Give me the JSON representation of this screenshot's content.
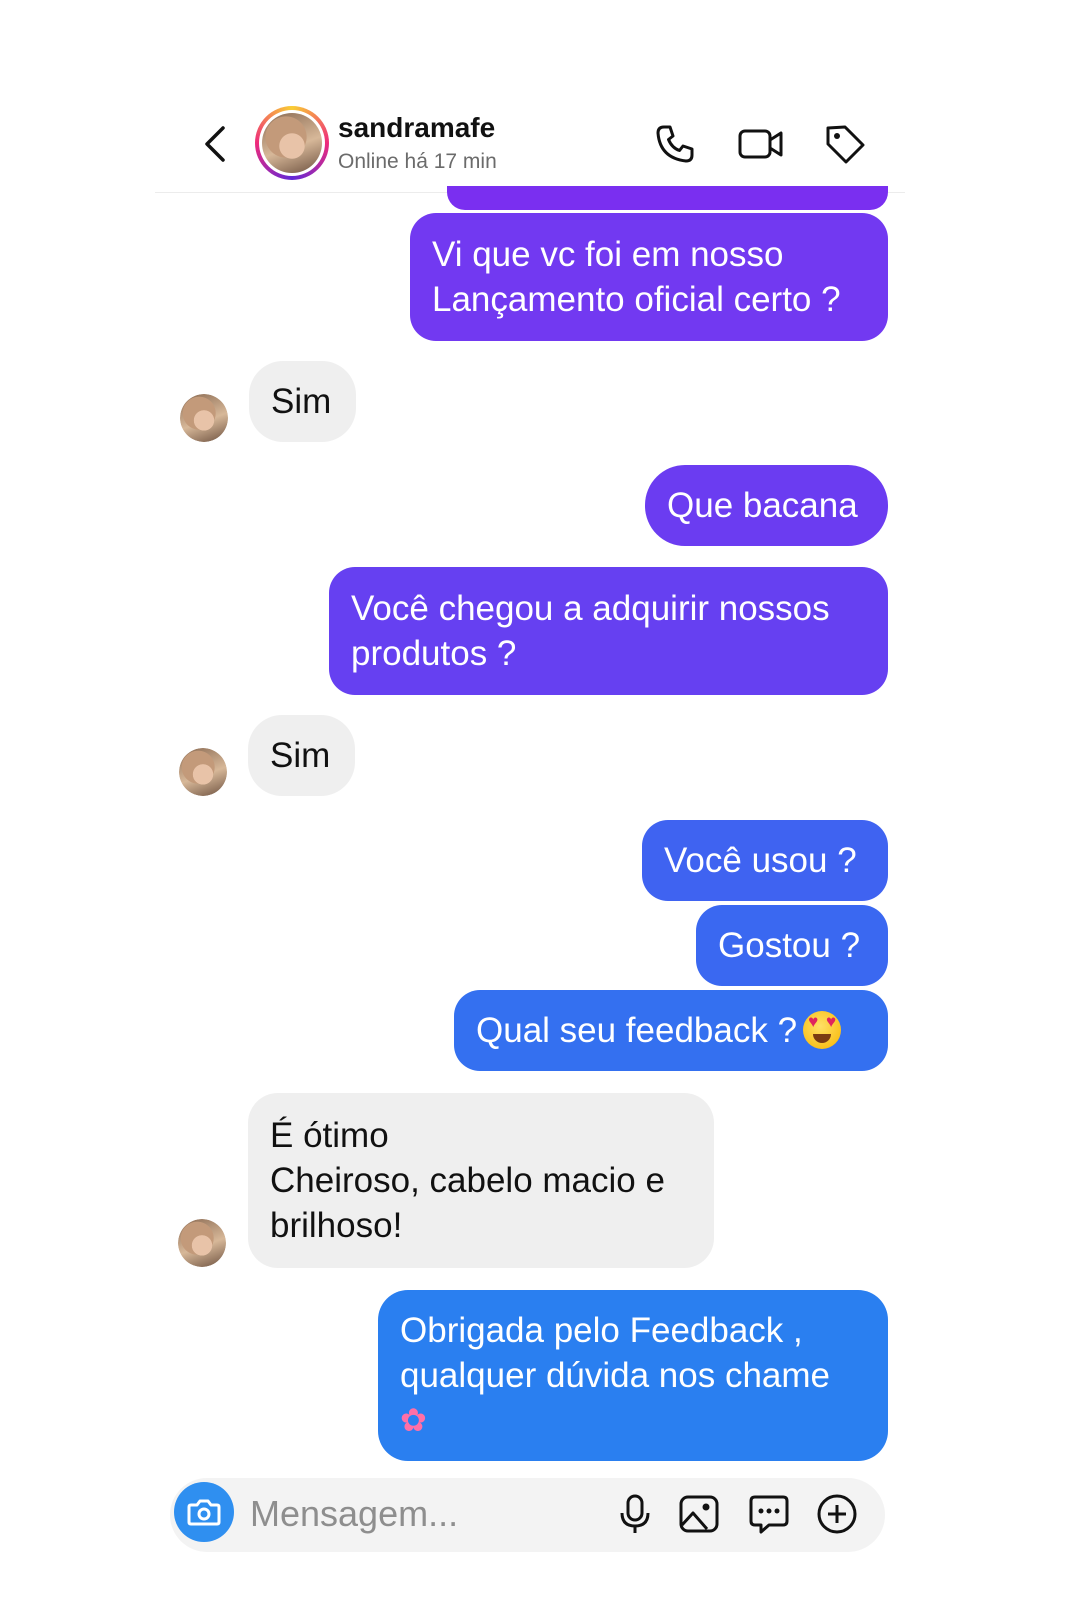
{
  "header": {
    "username": "sandramafe",
    "status": "Online há 17 min"
  },
  "messages": [
    {
      "side": "out",
      "text": "Vi que vc foi em nosso Lançamento oficial certo ?"
    },
    {
      "side": "in",
      "text": "Sim"
    },
    {
      "side": "out",
      "text": "Que bacana"
    },
    {
      "side": "out",
      "text": "Você chegou a adquirir nossos produtos ?"
    },
    {
      "side": "in",
      "text": "Sim"
    },
    {
      "side": "out",
      "text": "Você usou ?"
    },
    {
      "side": "out",
      "text": "Gostou ?"
    },
    {
      "side": "out",
      "text": "Qual seu feedback ?",
      "emoji": "smiling-face-with-heart-eyes"
    },
    {
      "side": "in",
      "lines": [
        "É ótimo",
        "Cheiroso, cabelo macio e brilhoso!"
      ]
    },
    {
      "side": "out",
      "text": "Obrigada pelo Feedback , qualquer dúvida nos chame",
      "emoji": "tulip"
    }
  ],
  "composer": {
    "placeholder": "Mensagem..."
  },
  "colors": {
    "bubble_purple": "#7239f1",
    "bubble_violet": "#5a4ef0",
    "bubble_blue": "#3470f0",
    "bubble_light_blue": "#2a7ff0",
    "incoming_bg": "#efefef",
    "camera_button": "#2f8ff0"
  }
}
